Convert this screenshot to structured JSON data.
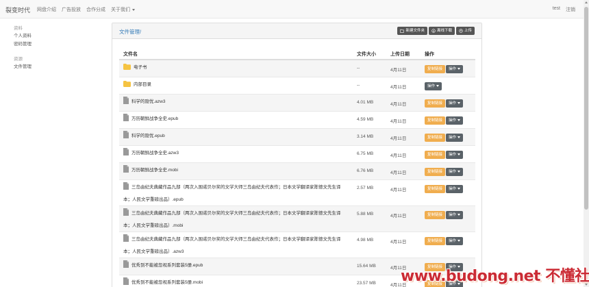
{
  "navbar": {
    "brand": "裂变时代",
    "links": [
      "网盘介绍",
      "广告投放",
      "合作分成",
      "关于我们"
    ],
    "user": "test",
    "logout": "注销"
  },
  "sidebar": {
    "groups": [
      {
        "heading": "资料",
        "items": [
          "个人资料",
          "密码管理"
        ]
      },
      {
        "heading": "资源",
        "items": [
          "文件管理"
        ]
      }
    ]
  },
  "panel": {
    "breadcrumb": "文件管理/",
    "buttons": {
      "new_folder": "新建文件夹",
      "offline_download": "离线下载",
      "upload": "上传"
    }
  },
  "table": {
    "headers": {
      "name": "文件名",
      "size": "文件大小",
      "date": "上传日期",
      "action": "操作"
    },
    "rows": [
      {
        "name": "电子书",
        "size": "--",
        "date": "4月11日",
        "type": "folder",
        "copy": true
      },
      {
        "name": "内部目录",
        "size": "--",
        "date": "4月11日",
        "type": "folder",
        "copy": false
      },
      {
        "name": "科学的隐忧.azw3",
        "size": "4.01 MB",
        "date": "4月11日",
        "type": "file",
        "copy": true
      },
      {
        "name": "万历朝鲜战争全史.epub",
        "size": "4.59 MB",
        "date": "4月11日",
        "type": "file",
        "copy": true
      },
      {
        "name": "科学的隐忧.epub",
        "size": "3.14 MB",
        "date": "4月11日",
        "type": "file",
        "copy": true
      },
      {
        "name": "万历朝鲜战争全史.azw3",
        "size": "6.75 MB",
        "date": "4月11日",
        "type": "file",
        "copy": true
      },
      {
        "name": "万历朝鲜战争全史.mobi",
        "size": "6.76 MB",
        "date": "4月11日",
        "type": "file",
        "copy": true
      },
      {
        "name": "三岛由纪夫典藏作品九部（两次入围诺贝尔奖的文学大师三岛由纪夫代表作；日本文学翻译家陈德文先生译本；人民文学重磅出品）.epub",
        "size": "2.57 MB",
        "date": "4月11日",
        "type": "file",
        "copy": true
      },
      {
        "name": "三岛由纪夫典藏作品九部（两次入围诺贝尔奖的文学大师三岛由纪夫代表作；日本文学翻译家陈德文先生译本；人民文学重磅出品）.mobi",
        "size": "5.88 MB",
        "date": "4月11日",
        "type": "file",
        "copy": true
      },
      {
        "name": "三岛由纪夫典藏作品九部（两次入围诺贝尔奖的文学大师三岛由纪夫代表作；日本文学翻译家陈德文先生译本；人民文学重磅出品）.azw3",
        "size": "4.98 MB",
        "date": "4月11日",
        "type": "file",
        "copy": true
      },
      {
        "name": "优秀到不能被忽视系列套装5册.epub",
        "size": "15.64 MB",
        "date": "4月11日",
        "type": "file",
        "copy": true
      },
      {
        "name": "优秀到不能被忽视系列套装5册.mobi",
        "size": "23.57 MB",
        "date": "4月11日",
        "type": "file",
        "copy": true
      }
    ],
    "copy_label": "复制链接",
    "op_label": "操作"
  },
  "watermark": "www.budong.net 不懂社区",
  "colors": {
    "copy_button": "#f0ad4e",
    "op_button": "#5a6268",
    "folder": "#f5c342",
    "link": "#337ab7",
    "watermark": "#c9202a"
  }
}
